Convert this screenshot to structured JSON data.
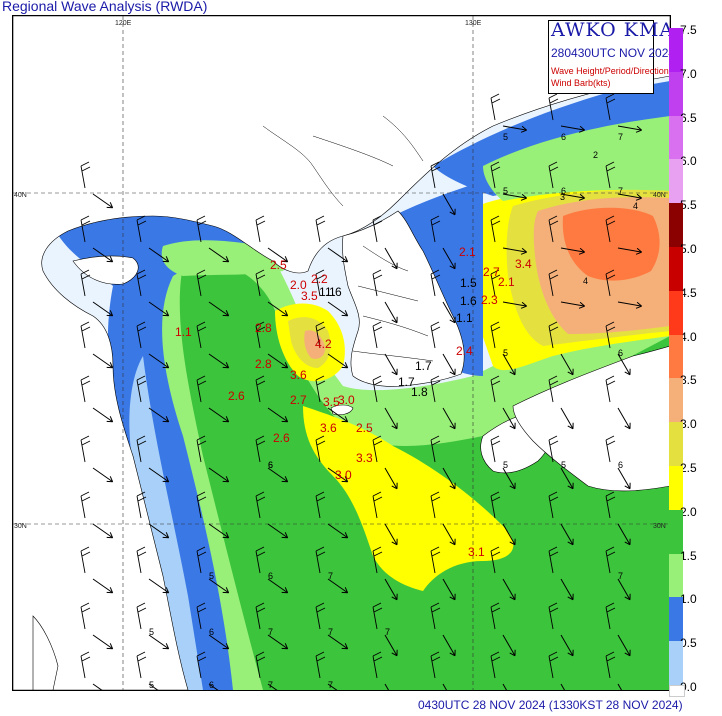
{
  "title": "Regional Wave Analysis (RWDA)",
  "legend": {
    "org": "AWKO  KMA",
    "time": "280430UTC NOV 2024",
    "line1": "Wave Height/Period/Direction",
    "line2": "Wind Barb(kts)"
  },
  "footer": "0430UTC 28 NOV 2024 (1330KST 28 NOV 2024)",
  "grid_labels": {
    "lon_120": "120E",
    "lon_130": "130E",
    "lat_40_left": "40N",
    "lat_40_right": "40N",
    "lat_30_left": "30N",
    "lat_30_right": "30N"
  },
  "scale": [
    {
      "label": "7.5",
      "color": "#b020f0"
    },
    {
      "label": "7.0",
      "color": "#c040f0"
    },
    {
      "label": "6.5",
      "color": "#d870f0"
    },
    {
      "label": "6.0",
      "color": "#e8a0f0"
    },
    {
      "label": "5.5",
      "color": "#8b0000"
    },
    {
      "label": "5.0",
      "color": "#c80000"
    },
    {
      "label": "4.5",
      "color": "#ff3a1a"
    },
    {
      "label": "4.0",
      "color": "#ff7a40"
    },
    {
      "label": "3.5",
      "color": "#f5b07a"
    },
    {
      "label": "3.0",
      "color": "#e3e040"
    },
    {
      "label": "2.5",
      "color": "#ffff00"
    },
    {
      "label": "2.0",
      "color": "#3cc43c"
    },
    {
      "label": "1.5",
      "color": "#98f078"
    },
    {
      "label": "1.0",
      "color": "#3a78e6"
    },
    {
      "label": "0.5",
      "color": "#a8d0f8"
    },
    {
      "label": "0.0",
      "color": "#eaf4ff"
    }
  ],
  "wave_labels_red": [
    "2.5",
    "2.2",
    "2.0",
    "3.5",
    "2.8",
    "4.2",
    "2.8",
    "3.6",
    "2.6",
    "2.7",
    "3.0",
    "3.6",
    "2.5",
    "2.6",
    "3.3",
    "3.0",
    "2.1",
    "2.7",
    "3.4",
    "2.3",
    "2.1",
    "2.4",
    "3.1",
    "1.1",
    "3.5"
  ],
  "wave_labels_black": [
    "1.5",
    "1.6",
    "1.1",
    "1.7",
    "1.8",
    "1.7",
    "1.1",
    "1.6"
  ],
  "periods": [
    "5",
    "6",
    "7",
    "5",
    "6",
    "7",
    "2",
    "3",
    "4",
    "4",
    "5",
    "6",
    "5",
    "6",
    "5",
    "6",
    "5",
    "6",
    "7",
    "6",
    "7",
    "5",
    "7",
    "7",
    "6",
    "7",
    "7",
    "5",
    "6",
    "7"
  ]
}
